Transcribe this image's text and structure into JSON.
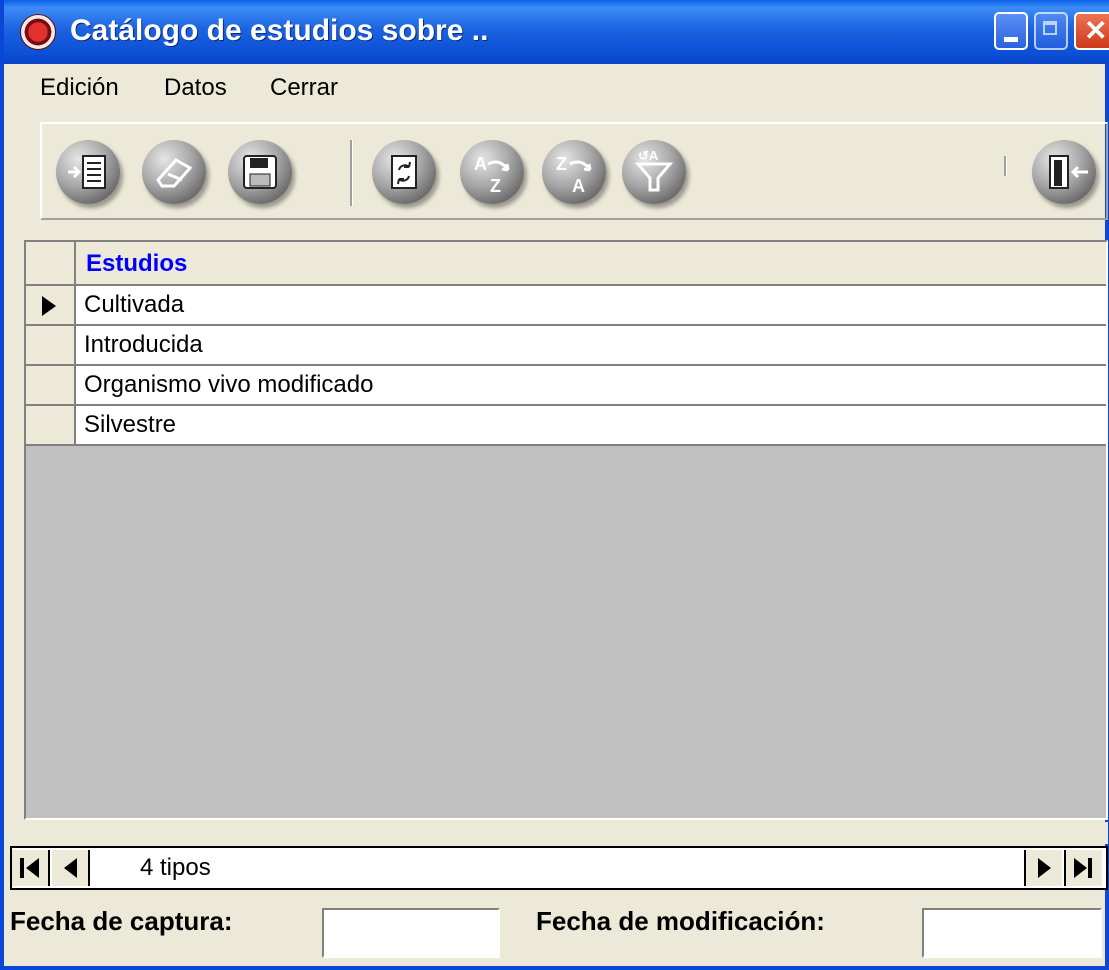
{
  "window": {
    "title": "Catálogo de estudios sobre ..",
    "colors": {
      "titlebar": "#0a5fe8",
      "close": "#d8401e",
      "background": "#ece9d8",
      "header_text": "#0000ff"
    }
  },
  "menu": {
    "items": [
      {
        "label": "Edición"
      },
      {
        "label": "Datos"
      },
      {
        "label": "Cerrar"
      }
    ]
  },
  "toolbar": {
    "buttons": [
      {
        "icon": "insert-record-icon"
      },
      {
        "icon": "eraser-icon"
      },
      {
        "icon": "floppy-disk-icon"
      },
      {
        "icon": "refresh-document-icon"
      },
      {
        "icon": "sort-ascending-icon"
      },
      {
        "icon": "sort-descending-icon"
      },
      {
        "icon": "filter-icon"
      },
      {
        "icon": "exit-door-icon"
      }
    ]
  },
  "grid": {
    "column_header": "Estudios",
    "rows": [
      "Cultivada",
      "Introducida",
      "Organismo vivo modificado",
      "Silvestre"
    ],
    "current_row_index": 0
  },
  "navigator": {
    "status": "4 tipos"
  },
  "footer": {
    "fecha_captura_label": "Fecha de captura:",
    "fecha_captura_value": "",
    "fecha_modificacion_label": "Fecha de modificación:",
    "fecha_modificacion_value": ""
  }
}
